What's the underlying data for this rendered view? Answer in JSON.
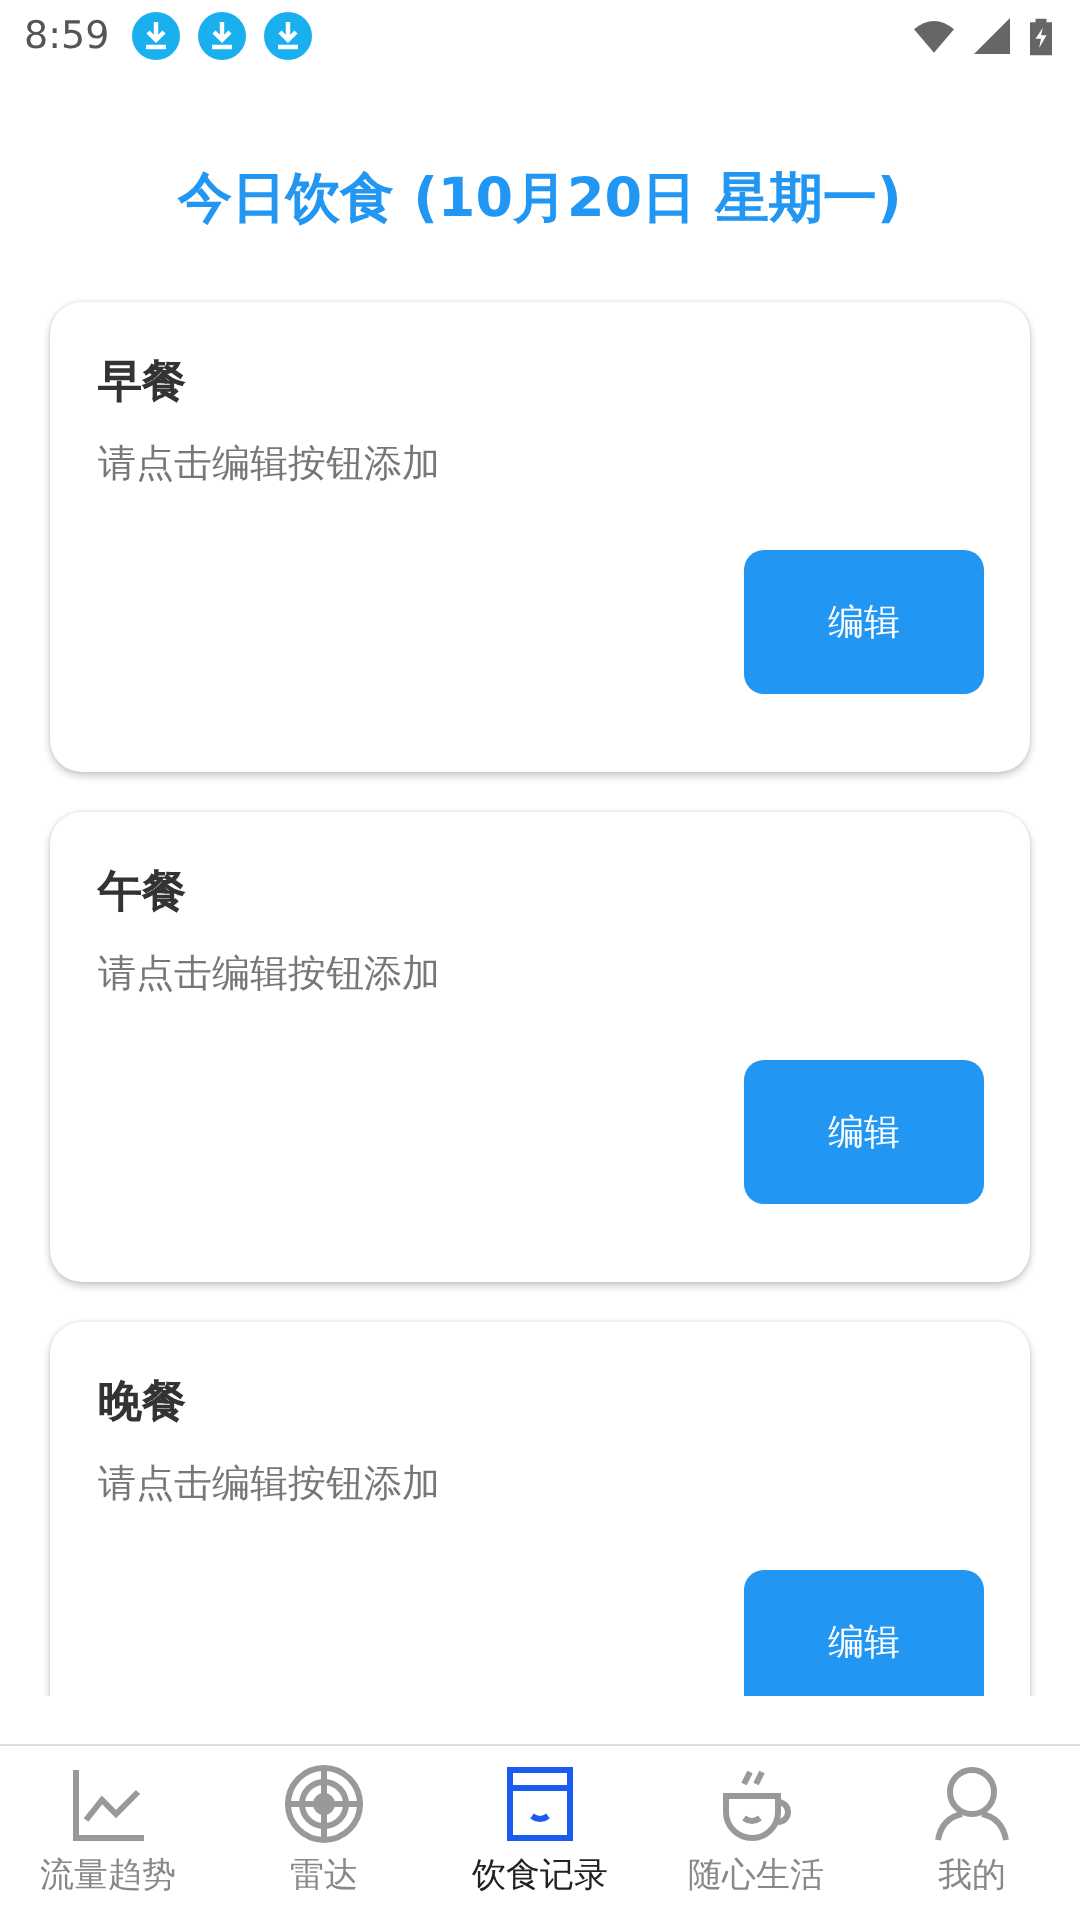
{
  "status_bar": {
    "time": "8:59",
    "notifications": [
      {
        "kind": "download"
      },
      {
        "kind": "download"
      },
      {
        "kind": "download"
      }
    ]
  },
  "title": "今日饮食 (10月20日 星期一)",
  "meals": [
    {
      "name": "早餐",
      "hint": "请点击编辑按钮添加",
      "button": "编辑"
    },
    {
      "name": "午餐",
      "hint": "请点击编辑按钮添加",
      "button": "编辑"
    },
    {
      "name": "晚餐",
      "hint": "请点击编辑按钮添加",
      "button": "编辑"
    }
  ],
  "nav": [
    {
      "label": "流量趋势",
      "kind": "chart",
      "selected": false
    },
    {
      "label": "雷达",
      "kind": "radar",
      "selected": false
    },
    {
      "label": "饮食记录",
      "kind": "food",
      "selected": true
    },
    {
      "label": "随心生活",
      "kind": "cup",
      "selected": false
    },
    {
      "label": "我的",
      "kind": "person",
      "selected": false
    }
  ]
}
